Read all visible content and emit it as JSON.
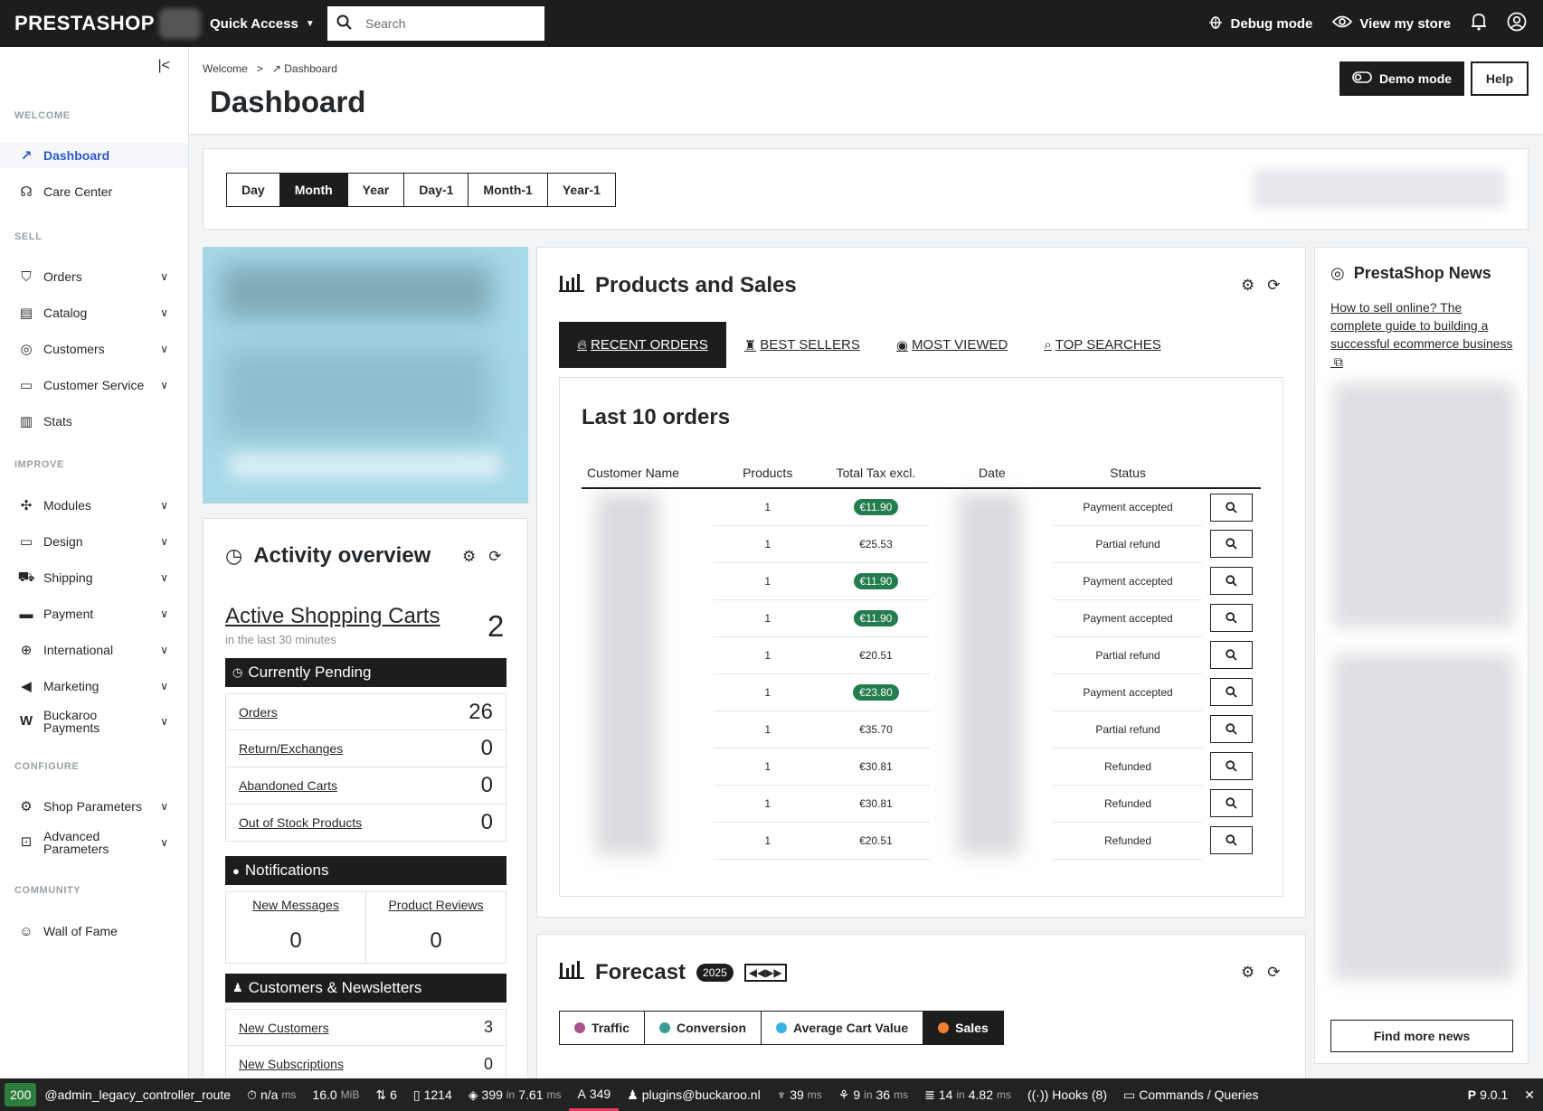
{
  "topbar": {
    "logo": "PRESTASHOP",
    "quick_access": "Quick Access",
    "search_placeholder": "Search",
    "debug_mode": "Debug mode",
    "view_store": "View my store"
  },
  "sidebar": {
    "sections": {
      "welcome": "WELCOME",
      "sell": "SELL",
      "improve": "IMPROVE",
      "configure": "CONFIGURE",
      "community": "COMMUNITY"
    },
    "items": [
      {
        "label": "Dashboard",
        "icon": "trending-up-icon"
      },
      {
        "label": "Care Center",
        "icon": "headset-icon"
      },
      {
        "label": "Orders",
        "icon": "basket-icon"
      },
      {
        "label": "Catalog",
        "icon": "store-icon"
      },
      {
        "label": "Customers",
        "icon": "user-circle-icon"
      },
      {
        "label": "Customer Service",
        "icon": "chat-icon"
      },
      {
        "label": "Stats",
        "icon": "chart-icon"
      },
      {
        "label": "Modules",
        "icon": "puzzle-icon"
      },
      {
        "label": "Design",
        "icon": "monitor-icon"
      },
      {
        "label": "Shipping",
        "icon": "truck-icon"
      },
      {
        "label": "Payment",
        "icon": "card-icon"
      },
      {
        "label": "International",
        "icon": "globe-icon"
      },
      {
        "label": "Marketing",
        "icon": "megaphone-icon"
      },
      {
        "label": "Buckaroo Payments",
        "icon": "buckaroo-icon"
      },
      {
        "label": "Shop Parameters",
        "icon": "gear-icon"
      },
      {
        "label": "Advanced Parameters",
        "icon": "settings-box-icon"
      },
      {
        "label": "Wall of Fame",
        "icon": "people-icon"
      }
    ]
  },
  "header": {
    "breadcrumb_root": "Welcome",
    "breadcrumb_current": "Dashboard",
    "title": "Dashboard",
    "demo_mode": "Demo mode",
    "help": "Help"
  },
  "periods": [
    "Day",
    "Month",
    "Year",
    "Day-1",
    "Month-1",
    "Year-1"
  ],
  "selected_period": "Month",
  "activity": {
    "title": "Activity overview",
    "active_carts_label": "Active Shopping Carts",
    "active_carts_sub": "in the last 30 minutes",
    "active_carts_value": "2",
    "pending_title": "Currently Pending",
    "pending": [
      {
        "label": "Orders",
        "value": "26"
      },
      {
        "label": "Return/Exchanges",
        "value": "0"
      },
      {
        "label": "Abandoned Carts",
        "value": "0"
      },
      {
        "label": "Out of Stock Products",
        "value": "0"
      }
    ],
    "notifications_title": "Notifications",
    "new_messages_label": "New Messages",
    "new_messages_value": "0",
    "product_reviews_label": "Product Reviews",
    "product_reviews_value": "0",
    "customers_title": "Customers & Newsletters",
    "customers": [
      {
        "label": "New Customers",
        "value": "3"
      },
      {
        "label": "New Subscriptions",
        "value": "0"
      }
    ]
  },
  "products": {
    "title": "Products and Sales",
    "tabs": [
      "RECENT ORDERS",
      "BEST SELLERS",
      "MOST VIEWED",
      "TOP SEARCHES"
    ],
    "orders_title": "Last 10 orders",
    "columns": [
      "Customer Name",
      "Products",
      "Total Tax excl.",
      "Date",
      "Status"
    ],
    "rows": [
      {
        "products": "1",
        "total": "€11.90",
        "status": "Payment accepted",
        "highlight": true
      },
      {
        "products": "1",
        "total": "€25.53",
        "status": "Partial refund",
        "highlight": false
      },
      {
        "products": "1",
        "total": "€11.90",
        "status": "Payment accepted",
        "highlight": true
      },
      {
        "products": "1",
        "total": "€11.90",
        "status": "Payment accepted",
        "highlight": true
      },
      {
        "products": "1",
        "total": "€20.51",
        "status": "Partial refund",
        "highlight": false
      },
      {
        "products": "1",
        "total": "€23.80",
        "status": "Payment accepted",
        "highlight": true
      },
      {
        "products": "1",
        "total": "€35.70",
        "status": "Partial refund",
        "highlight": false
      },
      {
        "products": "1",
        "total": "€30.81",
        "status": "Refunded",
        "highlight": false
      },
      {
        "products": "1",
        "total": "€30.81",
        "status": "Refunded",
        "highlight": false
      },
      {
        "products": "1",
        "total": "€20.51",
        "status": "Refunded",
        "highlight": false
      }
    ],
    "pill_color": "#237d4c"
  },
  "forecast": {
    "title": "Forecast",
    "year": "2025",
    "tabs": [
      {
        "label": "Traffic",
        "color": "#a9528f"
      },
      {
        "label": "Conversion",
        "color": "#3a9c96"
      },
      {
        "label": "Average Cart Value",
        "color": "#3bb3e0"
      },
      {
        "label": "Sales",
        "color": "#f0822f"
      }
    ]
  },
  "news": {
    "title": "PrestaShop News",
    "link": "How to sell online? The complete guide to building a successful ecommerce business",
    "find_more": "Find more news"
  },
  "debugbar": {
    "status": "200",
    "route": "@admin_legacy_controller_route",
    "time": "n/a",
    "time_unit": "ms",
    "memory": "16.0",
    "memory_unit": "MiB",
    "logs": "6",
    "requests": "1214",
    "cache_calls": "399",
    "cache_in": "in",
    "cache_time": "7.61",
    "cache_unit": "ms",
    "translations": "349",
    "user": "plugins@buckaroo.nl",
    "forms_time": "39",
    "forms_unit": "ms",
    "events": "9",
    "events_in": "in",
    "events_time": "36",
    "events_unit": "ms",
    "db": "14",
    "db_in": "in",
    "db_time": "4.82",
    "db_unit": "ms",
    "hooks": "Hooks (8)",
    "commands": "Commands / Queries",
    "version": "9.0.1"
  }
}
